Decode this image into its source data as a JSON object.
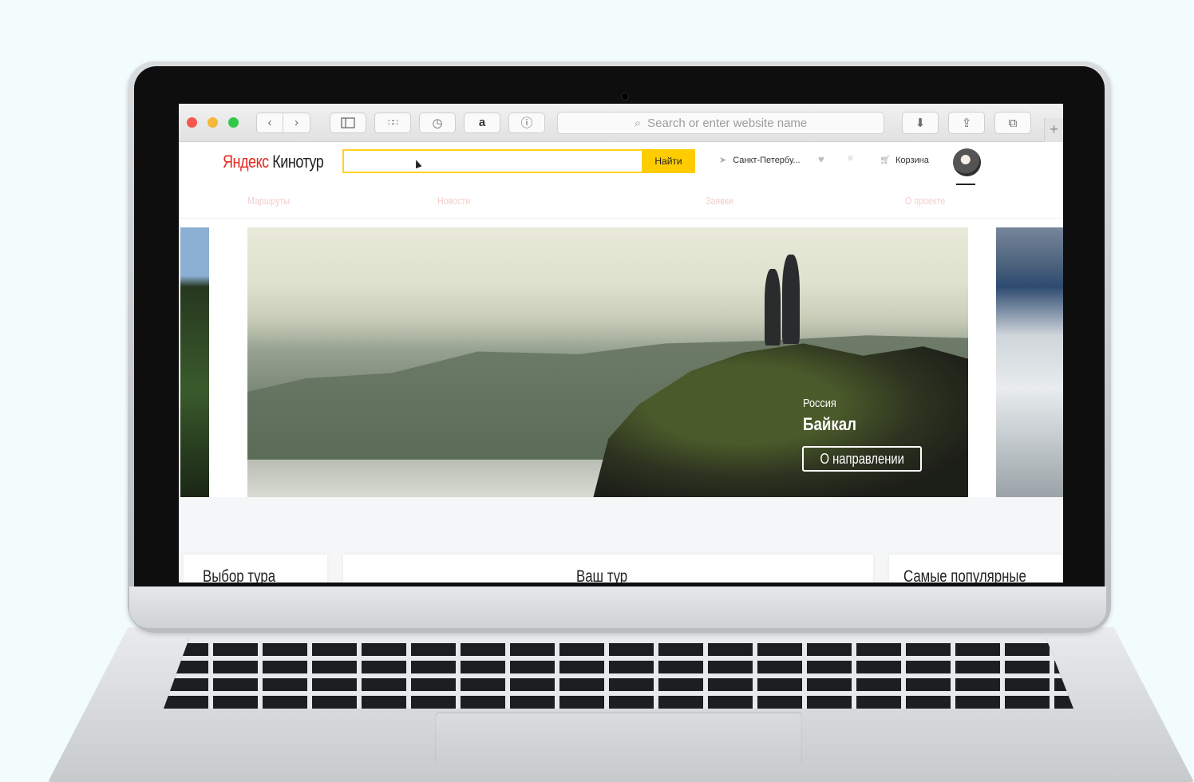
{
  "browser": {
    "url_placeholder": "Search or enter website name",
    "toolbar_icons": [
      "back-icon",
      "forward-icon",
      "sidebar-icon",
      "grid-icon",
      "history-icon",
      "amazon-icon",
      "info-icon",
      "download-icon",
      "share-icon",
      "tabs-icon",
      "new-tab-icon"
    ]
  },
  "site": {
    "logo_brand": "Яндекс",
    "logo_product": " Кинотур",
    "search_button": "Найти",
    "city": "Санкт-Петербу...",
    "cart": "Корзина"
  },
  "nav": {
    "items": [
      "Маршруты",
      "Новости",
      "Заявки",
      "О проекте"
    ]
  },
  "hero": {
    "country": "Россия",
    "title": "Байкал",
    "button": "О направлении"
  },
  "sections": {
    "left": "Выбор тура",
    "center": "Ваш тур",
    "right": "Самые популярные"
  },
  "colors": {
    "accent_yellow": "#ffcc00",
    "logo_red": "#e42a20",
    "nav_text": "#f2cfcc"
  }
}
